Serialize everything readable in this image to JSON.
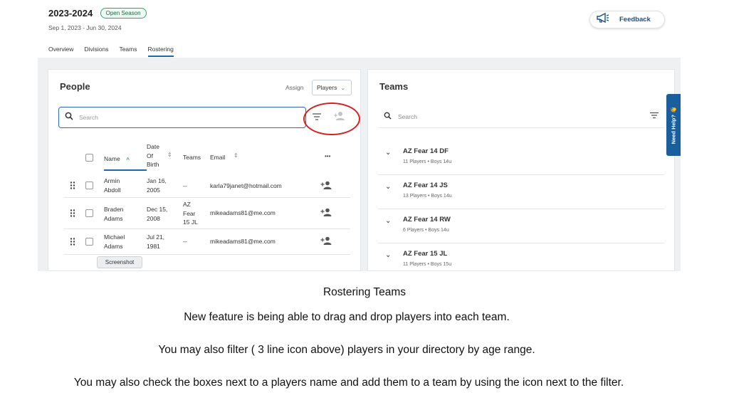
{
  "header": {
    "season_title": "2023-2024",
    "season_badge": "Open Season",
    "season_dates": "Sep 1, 2023 - Jun 30, 2024",
    "feedback_label": "Feedback"
  },
  "nav_tabs": [
    "Overview",
    "Divisions",
    "Teams",
    "Rostering"
  ],
  "active_tab": "Rostering",
  "people_panel": {
    "title": "People",
    "assign_label": "Assign",
    "assign_select_value": "Players",
    "search_placeholder": "Search",
    "columns": {
      "name": "Name",
      "dob_line1": "Date",
      "dob_line2": "Of",
      "dob_line3": "Birth",
      "teams": "Teams",
      "email": "Email",
      "more": "•••"
    },
    "rows": [
      {
        "first": "Armin",
        "last": "Abdoll",
        "dob1": "Jan 16,",
        "dob2": "2005",
        "teams": "--",
        "email": "karla79janet@hotmail.com"
      },
      {
        "first": "Braden",
        "last": "Adams",
        "dob1": "Dec 15,",
        "dob2": "2008",
        "teams": "AZ Fear 15 JL",
        "teams1": "AZ",
        "teams2": "Fear",
        "teams3": "15 JL",
        "email": "mikeadams81@me.com"
      },
      {
        "first": "Michael",
        "last": "Adams",
        "dob1": "Jul 21,",
        "dob2": "1981",
        "teams": "--",
        "email": "mikeadams81@me.com"
      }
    ],
    "tooltip": "Screenshot"
  },
  "teams_panel": {
    "title": "Teams",
    "search_placeholder": "Search",
    "teams": [
      {
        "name": "AZ Fear 14 DF",
        "players": "11 Players",
        "division": "Boys 14u"
      },
      {
        "name": "AZ Fear 14 JS",
        "players": "13 Players",
        "division": "Boys 14u"
      },
      {
        "name": "AZ Fear 14 RW",
        "players": "6 Players",
        "division": "Boys 14u"
      },
      {
        "name": "AZ Fear 15 JL",
        "players": "11 Players",
        "division": "Boys 15u"
      }
    ]
  },
  "need_help": "Need Help? 👋",
  "captions": {
    "title": "Rostering Teams",
    "line1": "New feature is being able to drag and drop players into each team.",
    "line2": "You may also filter ( 3 line icon above) players in your directory by age range.",
    "line3": "You may also check the boxes next to a players name and add them to a team by using the icon next to the filter."
  },
  "colors": {
    "accent": "#1a6aa8",
    "badge_green": "#2fa36b",
    "highlight_red": "#d82020",
    "need_help_blue": "#1a5e9e"
  },
  "icons": [
    "megaphone-icon",
    "search-icon",
    "filter-icon",
    "add-person-icon",
    "grip-icon",
    "chevron-down-icon",
    "sort-icon"
  ]
}
